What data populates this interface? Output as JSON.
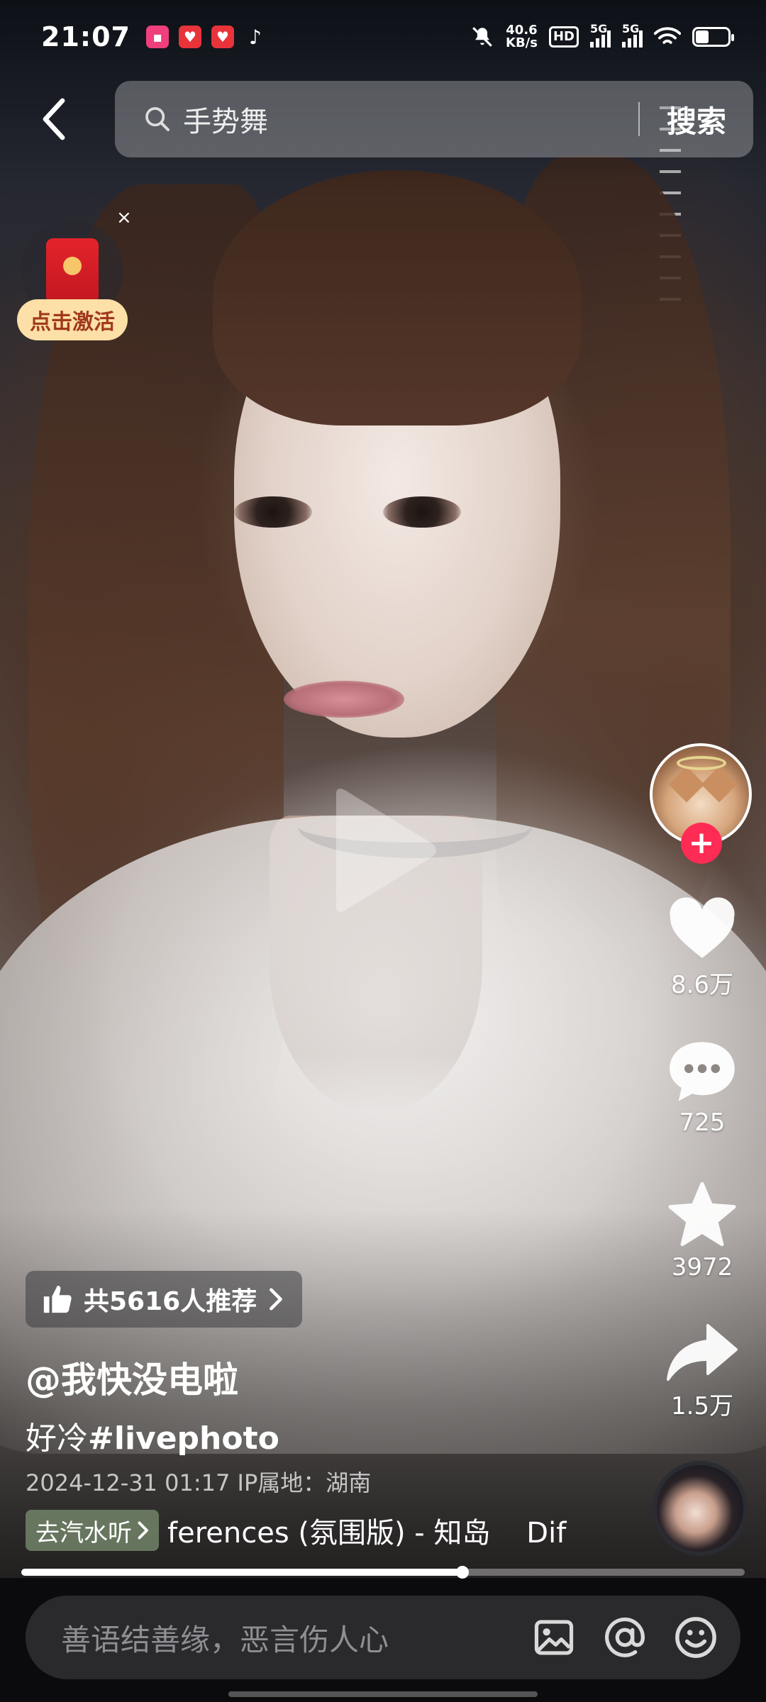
{
  "status_bar": {
    "time": "21:07",
    "speed_value": "40.6",
    "speed_unit": "KB/s",
    "hd_label": "HD",
    "signal1_label": "5G",
    "signal2_label": "5G"
  },
  "search": {
    "query": "手势舞",
    "button_label": "搜索"
  },
  "red_packet": {
    "close_label": "×",
    "action_label": "点击激活"
  },
  "rail": {
    "follow_label": "+",
    "likes": "8.6万",
    "comments": "725",
    "favorites": "3972",
    "shares": "1.5万"
  },
  "video": {
    "recommend_text": "共5616人推荐",
    "author": "@我快没电啦",
    "caption_text": "好冷",
    "caption_tag": "#livephoto",
    "meta": "2024-12-31 01:17  IP属地：湖南",
    "music_chip_label": "去汽水听",
    "music_title": "ferences (氛围版) - 知岛    Dif",
    "progress": 0.61
  },
  "comment_bar": {
    "placeholder": "善语结善缘，恶言伤人心"
  },
  "colors": {
    "accent_red": "#fe2c55",
    "red_packet_label_bg": "#fde0a7",
    "music_chip_bg": "#788c6e"
  }
}
